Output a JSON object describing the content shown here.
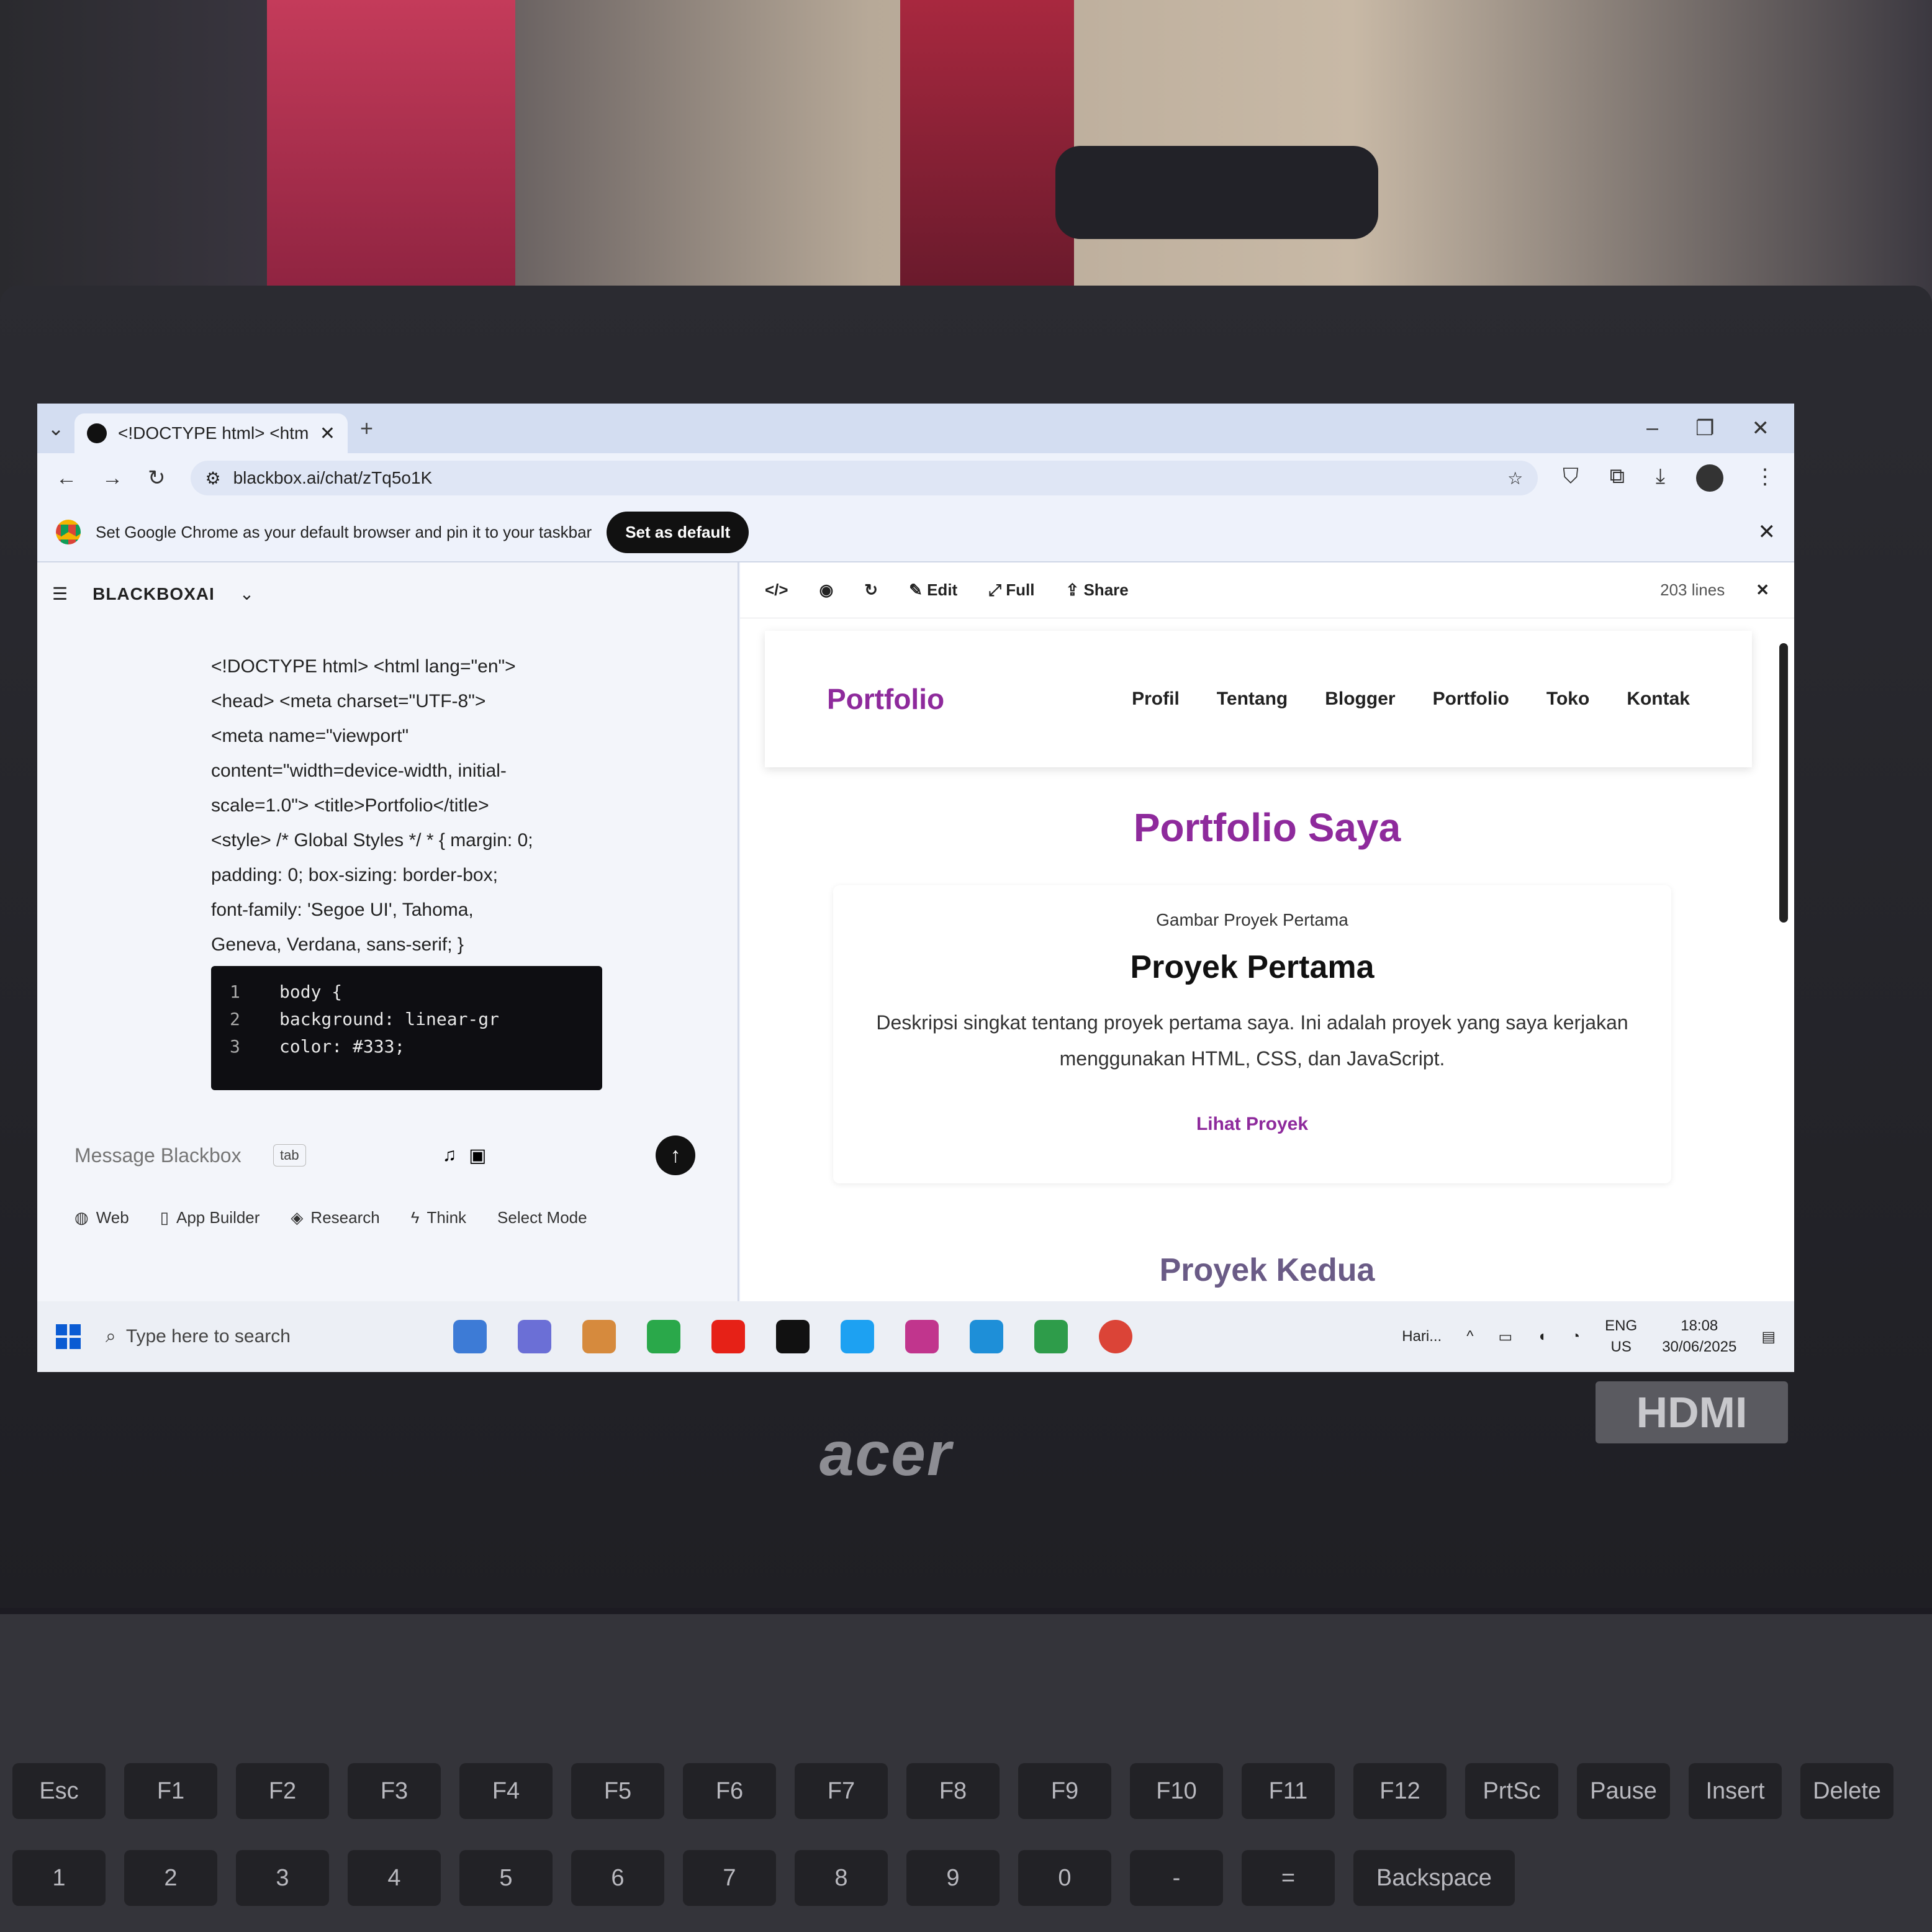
{
  "browser": {
    "tab_title": "<!DOCTYPE html> <html lang=",
    "url": "blackbox.ai/chat/zTq5o1K",
    "infobar_text": "Set Google Chrome as your default browser and pin it to your taskbar",
    "set_default_label": "Set as default"
  },
  "chat": {
    "brand": "BLACKBOXAI",
    "code_text_lines": [
      "<!DOCTYPE html> <html lang=\"en\">",
      "<head> <meta charset=\"UTF-8\">",
      "<meta name=\"viewport\"",
      "content=\"width=device-width, initial-",
      "scale=1.0\"> <title>Portfolio</title>",
      "<style> /* Global Styles */ * { margin: 0;",
      "padding: 0; box-sizing: border-box;",
      "font-family: 'Segoe UI', Tahoma,",
      "Geneva, Verdana, sans-serif; }"
    ],
    "code_block": [
      {
        "num": "1",
        "code": "body {"
      },
      {
        "num": "2",
        "code": "    background: linear-gr"
      },
      {
        "num": "3",
        "code": "    color: #333;"
      }
    ],
    "input_placeholder": "Message Blackbox",
    "tab_hint": "tab",
    "modes": [
      "Web",
      "App Builder",
      "Research",
      "Think",
      "Select Mode"
    ]
  },
  "preview": {
    "toolbar": {
      "edit": "Edit",
      "full": "Full",
      "share": "Share",
      "lines": "203 lines"
    },
    "logo": "Portfolio",
    "nav": [
      "Profil",
      "Tentang",
      "Blogger",
      "Portfolio",
      "Toko",
      "Kontak"
    ],
    "heading": "Portfolio Saya",
    "card": {
      "img_alt": "Gambar Proyek Pertama",
      "title": "Proyek Pertama",
      "description": "Deskripsi singkat tentang proyek pertama saya. Ini adalah proyek yang saya kerjakan menggunakan HTML, CSS, dan JavaScript.",
      "link": "Lihat Proyek"
    },
    "next_heading": "Proyek Kedua"
  },
  "taskbar": {
    "search_placeholder": "Type here to search",
    "weather": "Hari...",
    "lang_top": "ENG",
    "lang_bottom": "US",
    "time": "18:08",
    "date": "30/06/2025"
  },
  "hardware": {
    "brand": "acer",
    "port_badge": "HDMI",
    "fn_keys": [
      "Esc",
      "F1",
      "F2",
      "F3",
      "F4",
      "F5",
      "F6",
      "F7",
      "F8",
      "F9",
      "F10",
      "F11",
      "F12",
      "PrtSc",
      "Pause",
      "Insert",
      "Delete"
    ],
    "num_keys": [
      "1",
      "2",
      "3",
      "4",
      "5",
      "6",
      "7",
      "8",
      "9",
      "0",
      "-",
      "=",
      "Backspace"
    ]
  }
}
